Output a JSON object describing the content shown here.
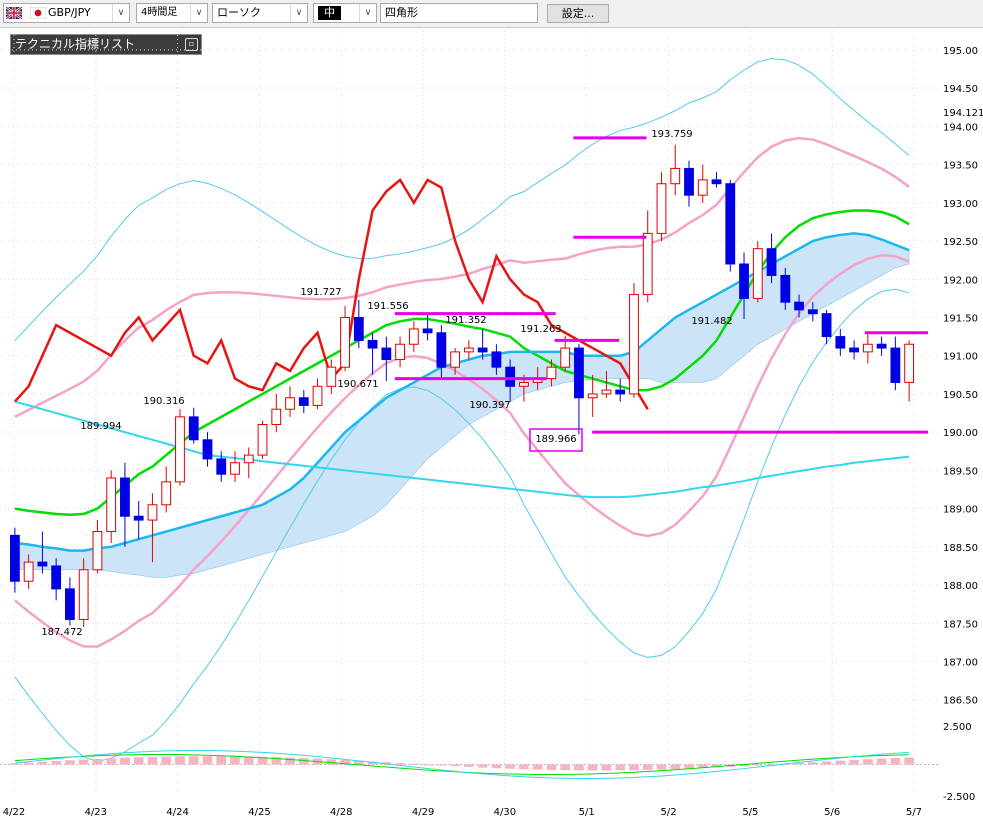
{
  "toolbar": {
    "symbol": "GBP/JPY",
    "timeframe": "4時間足",
    "chart_style": "ローソク",
    "line_width": "中",
    "drawing_tool": "四角形",
    "settings_label": "設定..."
  },
  "indicator_panel": {
    "title": "テクニカル指標リスト"
  },
  "colors": {
    "bull_candle": "#e00000",
    "bear_candle": "#0000e6",
    "ma_fast": "#00dd00",
    "ma_mid": "#19b8f0",
    "ma_slow": "#33d6ea",
    "bb_outer": "#55c9ec",
    "bb_inner": "#f7a1c8",
    "cloud_bull": "#cce4f7",
    "cloud_bear": "#f8c8d8",
    "rsi_line": "#e81414",
    "hline": "#e600e6"
  },
  "chart_data": {
    "type": "candlestick",
    "y_axis": {
      "ticks": [
        "195.00",
        "194.50",
        "194.00",
        "193.50",
        "193.00",
        "192.50",
        "192.00",
        "191.50",
        "191.00",
        "190.50",
        "190.00",
        "189.50",
        "189.00",
        "188.50",
        "188.00",
        "187.50",
        "187.00",
        "186.50"
      ],
      "ylim": [
        186.3,
        195.3
      ],
      "current_price": "194.121"
    },
    "x_axis": {
      "labels": [
        "4/22",
        "4/23",
        "4/24",
        "4/25",
        "4/28",
        "4/29",
        "4/30",
        "5/1",
        "5/2",
        "5/5",
        "5/6",
        "5/7"
      ]
    },
    "annotations": [
      "191.727",
      "191.556",
      "191.352",
      "190.671",
      "190.316",
      "189.994",
      "191.263",
      "190.397",
      "189.966",
      "193.759",
      "191.482",
      "187.472"
    ],
    "sub_axis": {
      "ticks": [
        "2.500",
        "-2.500"
      ]
    },
    "candles": [
      {
        "o": 188.65,
        "h": 188.75,
        "l": 187.9,
        "c": 188.05
      },
      {
        "o": 188.05,
        "h": 188.4,
        "l": 187.95,
        "c": 188.3
      },
      {
        "o": 188.3,
        "h": 188.7,
        "l": 188.15,
        "c": 188.25
      },
      {
        "o": 188.25,
        "h": 188.35,
        "l": 187.8,
        "c": 187.95
      },
      {
        "o": 187.95,
        "h": 188.1,
        "l": 187.47,
        "c": 187.55
      },
      {
        "o": 187.55,
        "h": 188.35,
        "l": 187.45,
        "c": 188.2
      },
      {
        "o": 188.2,
        "h": 188.85,
        "l": 188.15,
        "c": 188.7
      },
      {
        "o": 188.7,
        "h": 189.5,
        "l": 188.55,
        "c": 189.4
      },
      {
        "o": 189.4,
        "h": 189.6,
        "l": 188.5,
        "c": 188.9
      },
      {
        "o": 188.9,
        "h": 189.1,
        "l": 188.6,
        "c": 188.85
      },
      {
        "o": 188.85,
        "h": 189.2,
        "l": 188.3,
        "c": 189.05
      },
      {
        "o": 189.05,
        "h": 189.55,
        "l": 188.95,
        "c": 189.35
      },
      {
        "o": 189.35,
        "h": 190.3,
        "l": 189.3,
        "c": 190.2
      },
      {
        "o": 190.2,
        "h": 190.32,
        "l": 189.85,
        "c": 189.9
      },
      {
        "o": 189.9,
        "h": 190.0,
        "l": 189.55,
        "c": 189.65
      },
      {
        "o": 189.65,
        "h": 189.75,
        "l": 189.35,
        "c": 189.45
      },
      {
        "o": 189.45,
        "h": 189.75,
        "l": 189.35,
        "c": 189.6
      },
      {
        "o": 189.6,
        "h": 189.8,
        "l": 189.4,
        "c": 189.7
      },
      {
        "o": 189.7,
        "h": 190.15,
        "l": 189.65,
        "c": 190.1
      },
      {
        "o": 190.1,
        "h": 190.5,
        "l": 190.0,
        "c": 190.3
      },
      {
        "o": 190.3,
        "h": 190.6,
        "l": 190.2,
        "c": 190.45
      },
      {
        "o": 190.45,
        "h": 190.55,
        "l": 190.25,
        "c": 190.35
      },
      {
        "o": 190.35,
        "h": 190.7,
        "l": 190.3,
        "c": 190.6
      },
      {
        "o": 190.6,
        "h": 190.95,
        "l": 190.5,
        "c": 190.85
      },
      {
        "o": 190.85,
        "h": 191.65,
        "l": 190.8,
        "c": 191.5
      },
      {
        "o": 191.5,
        "h": 191.73,
        "l": 191.1,
        "c": 191.2
      },
      {
        "o": 191.2,
        "h": 191.3,
        "l": 190.75,
        "c": 191.1
      },
      {
        "o": 191.1,
        "h": 191.25,
        "l": 190.67,
        "c": 190.95
      },
      {
        "o": 190.95,
        "h": 191.25,
        "l": 190.85,
        "c": 191.15
      },
      {
        "o": 191.15,
        "h": 191.45,
        "l": 191.05,
        "c": 191.35
      },
      {
        "o": 191.35,
        "h": 191.56,
        "l": 191.2,
        "c": 191.3
      },
      {
        "o": 191.3,
        "h": 191.4,
        "l": 190.7,
        "c": 190.85
      },
      {
        "o": 190.85,
        "h": 191.1,
        "l": 190.75,
        "c": 191.05
      },
      {
        "o": 191.05,
        "h": 191.2,
        "l": 190.95,
        "c": 191.1
      },
      {
        "o": 191.1,
        "h": 191.35,
        "l": 190.95,
        "c": 191.05
      },
      {
        "o": 191.05,
        "h": 191.15,
        "l": 190.75,
        "c": 190.85
      },
      {
        "o": 190.85,
        "h": 190.95,
        "l": 190.4,
        "c": 190.6
      },
      {
        "o": 190.6,
        "h": 190.75,
        "l": 190.4,
        "c": 190.65
      },
      {
        "o": 190.65,
        "h": 190.85,
        "l": 190.55,
        "c": 190.7
      },
      {
        "o": 190.7,
        "h": 190.95,
        "l": 190.6,
        "c": 190.85
      },
      {
        "o": 190.85,
        "h": 191.26,
        "l": 190.8,
        "c": 191.1
      },
      {
        "o": 191.1,
        "h": 191.15,
        "l": 189.97,
        "c": 190.45
      },
      {
        "o": 190.45,
        "h": 190.75,
        "l": 190.2,
        "c": 190.5
      },
      {
        "o": 190.5,
        "h": 190.8,
        "l": 190.45,
        "c": 190.55
      },
      {
        "o": 190.55,
        "h": 190.7,
        "l": 190.4,
        "c": 190.5
      },
      {
        "o": 190.5,
        "h": 191.95,
        "l": 190.45,
        "c": 191.8
      },
      {
        "o": 191.8,
        "h": 192.9,
        "l": 191.7,
        "c": 192.6
      },
      {
        "o": 192.6,
        "h": 193.4,
        "l": 192.5,
        "c": 193.25
      },
      {
        "o": 193.25,
        "h": 193.76,
        "l": 193.1,
        "c": 193.45
      },
      {
        "o": 193.45,
        "h": 193.55,
        "l": 192.95,
        "c": 193.1
      },
      {
        "o": 193.1,
        "h": 193.5,
        "l": 193.0,
        "c": 193.3
      },
      {
        "o": 193.3,
        "h": 193.4,
        "l": 193.2,
        "c": 193.25
      },
      {
        "o": 193.25,
        "h": 193.3,
        "l": 192.1,
        "c": 192.2
      },
      {
        "o": 192.2,
        "h": 192.35,
        "l": 191.48,
        "c": 191.75
      },
      {
        "o": 191.75,
        "h": 192.5,
        "l": 191.7,
        "c": 192.4
      },
      {
        "o": 192.4,
        "h": 192.6,
        "l": 191.95,
        "c": 192.05
      },
      {
        "o": 192.05,
        "h": 192.15,
        "l": 191.6,
        "c": 191.7
      },
      {
        "o": 191.7,
        "h": 191.8,
        "l": 191.5,
        "c": 191.6
      },
      {
        "o": 191.6,
        "h": 191.7,
        "l": 191.45,
        "c": 191.55
      },
      {
        "o": 191.55,
        "h": 191.6,
        "l": 191.15,
        "c": 191.25
      },
      {
        "o": 191.25,
        "h": 191.35,
        "l": 191.0,
        "c": 191.1
      },
      {
        "o": 191.1,
        "h": 191.2,
        "l": 190.95,
        "c": 191.05
      },
      {
        "o": 191.05,
        "h": 191.3,
        "l": 190.9,
        "c": 191.15
      },
      {
        "o": 191.15,
        "h": 191.25,
        "l": 191.0,
        "c": 191.1
      },
      {
        "o": 191.1,
        "h": 191.25,
        "l": 190.55,
        "c": 190.65
      },
      {
        "o": 190.65,
        "h": 191.2,
        "l": 190.4,
        "c": 191.15
      }
    ],
    "series": [
      {
        "kind": "ma_fast",
        "values": [
          189.0,
          188.97,
          188.95,
          188.93,
          188.92,
          188.93,
          189.0,
          189.15,
          189.3,
          189.45,
          189.55,
          189.7,
          189.85,
          190.0,
          190.1,
          190.2,
          190.3,
          190.4,
          190.5,
          190.6,
          190.7,
          190.8,
          190.9,
          191.0,
          191.1,
          191.2,
          191.3,
          191.4,
          191.45,
          191.48,
          191.48,
          191.45,
          191.42,
          191.38,
          191.35,
          191.3,
          191.25,
          191.1,
          191.0,
          190.9,
          190.8,
          190.75,
          190.7,
          190.65,
          190.6,
          190.55,
          190.55,
          190.6,
          190.7,
          190.85,
          191.0,
          191.2,
          191.5,
          191.8,
          192.1,
          192.35,
          192.55,
          192.7,
          192.8,
          192.85,
          192.88,
          192.9,
          192.9,
          192.88,
          192.82,
          192.72
        ]
      },
      {
        "kind": "ma_mid",
        "values": [
          188.55,
          188.53,
          188.5,
          188.48,
          188.45,
          188.45,
          188.48,
          188.5,
          188.55,
          188.6,
          188.65,
          188.7,
          188.75,
          188.8,
          188.85,
          188.9,
          188.95,
          189.0,
          189.05,
          189.15,
          189.25,
          189.4,
          189.6,
          189.8,
          190.0,
          190.15,
          190.3,
          190.45,
          190.55,
          190.65,
          190.75,
          190.85,
          190.9,
          190.95,
          191.0,
          191.02,
          191.05,
          191.05,
          191.05,
          191.05,
          191.05,
          191.0,
          191.0,
          191.0,
          191.0,
          191.05,
          191.2,
          191.35,
          191.5,
          191.6,
          191.7,
          191.8,
          191.9,
          192.0,
          192.1,
          192.2,
          192.3,
          192.4,
          192.5,
          192.55,
          192.58,
          192.6,
          192.58,
          192.52,
          192.45,
          192.38
        ]
      },
      {
        "kind": "ma_slow",
        "values": [
          190.4,
          190.35,
          190.3,
          190.25,
          190.2,
          190.15,
          190.1,
          190.05,
          190.0,
          189.95,
          189.9,
          189.85,
          189.8,
          189.75,
          189.7,
          189.68,
          189.66,
          189.64,
          189.62,
          189.6,
          189.58,
          189.56,
          189.54,
          189.52,
          189.5,
          189.48,
          189.46,
          189.44,
          189.42,
          189.4,
          189.38,
          189.36,
          189.34,
          189.32,
          189.3,
          189.28,
          189.26,
          189.24,
          189.22,
          189.2,
          189.18,
          189.16,
          189.15,
          189.15,
          189.15,
          189.16,
          189.18,
          189.2,
          189.22,
          189.25,
          189.28,
          189.3,
          189.33,
          189.36,
          189.4,
          189.43,
          189.46,
          189.49,
          189.52,
          189.55,
          189.57,
          189.6,
          189.62,
          189.64,
          189.66,
          189.68
        ]
      },
      {
        "kind": "rsi_line",
        "values": [
          190.4,
          190.6,
          191.0,
          191.4,
          191.3,
          191.2,
          191.1,
          191.0,
          191.3,
          191.5,
          191.2,
          191.4,
          191.6,
          191.0,
          190.9,
          191.2,
          190.7,
          190.6,
          190.55,
          190.9,
          190.8,
          191.1,
          191.3,
          190.7,
          190.9,
          192.0,
          192.9,
          193.15,
          193.3,
          193.0,
          193.3,
          193.2,
          192.5,
          192.0,
          191.7,
          192.3,
          192.0,
          191.8,
          191.7,
          191.4,
          191.3,
          191.2,
          191.1,
          191.0,
          190.9,
          190.6,
          190.3
        ]
      }
    ],
    "hlines": [
      {
        "value": 193.85,
        "x_from": 0.61,
        "x_to": 0.69
      },
      {
        "value": 192.55,
        "x_from": 0.61,
        "x_to": 0.69
      },
      {
        "value": 191.55,
        "x_from": 0.42,
        "x_to": 0.59
      },
      {
        "value": 191.2,
        "x_from": 0.59,
        "x_to": 0.66
      },
      {
        "value": 190.7,
        "x_from": 0.42,
        "x_to": 0.58
      },
      {
        "value": 190.0,
        "x_from": 0.63,
        "x_to": 1.0
      },
      {
        "value": 191.3,
        "x_from": 0.92,
        "x_to": 1.0
      }
    ]
  }
}
